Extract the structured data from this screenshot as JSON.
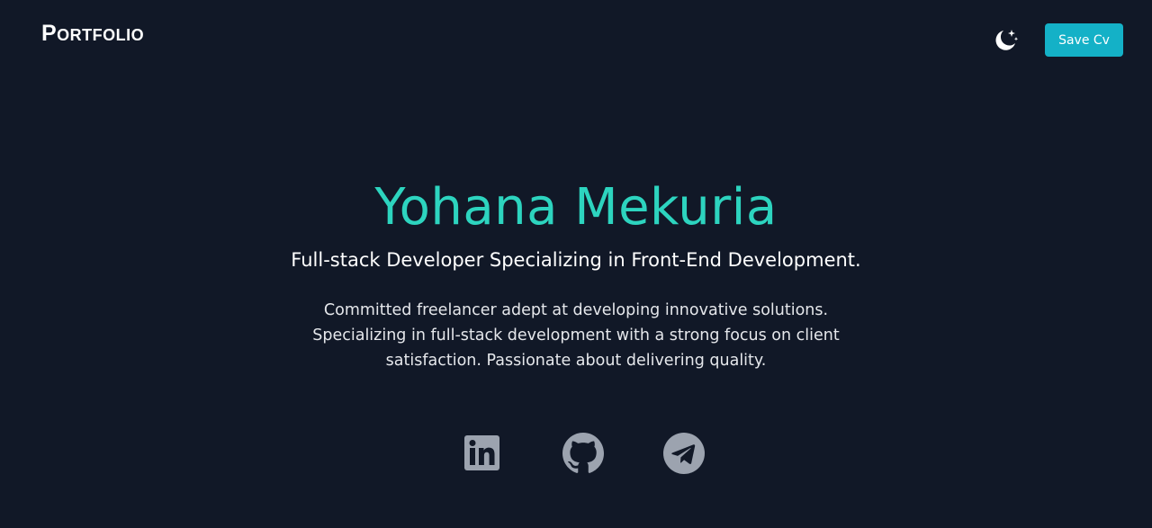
{
  "navbar": {
    "logo": "Portfolio",
    "theme_toggle_icon": "moon-stars-icon",
    "save_cv_label": "Save Cv"
  },
  "hero": {
    "name": "Yohana Mekuria",
    "subtitle": "Full-stack Developer Specializing in Front-End Development.",
    "bio": "Committed freelancer adept at developing innovative solutions. Specializing in full-stack development with a strong focus on client satisfaction. Passionate about delivering quality."
  },
  "socials": [
    {
      "icon": "linkedin-icon"
    },
    {
      "icon": "github-icon"
    },
    {
      "icon": "telegram-icon"
    }
  ],
  "colors": {
    "background": "#111827",
    "accent": "#2dd4bf",
    "button": "#14b1c7",
    "icon": "#9ca3af"
  }
}
